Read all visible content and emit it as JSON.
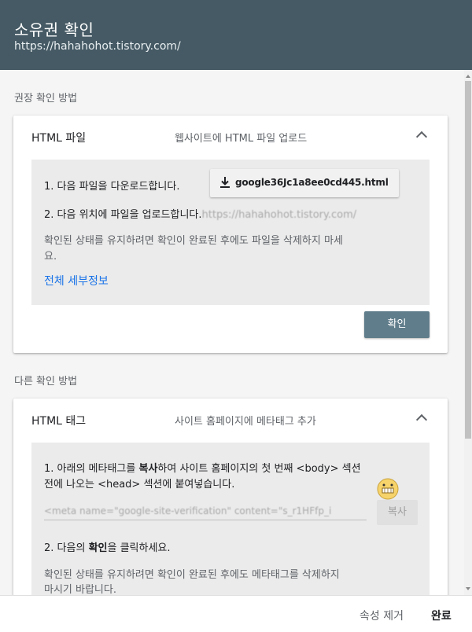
{
  "header": {
    "title": "소유권 확인",
    "url": "https://hahahohot.tistory.com/"
  },
  "recommended": {
    "section_label": "권장 확인 방법",
    "card": {
      "title": "HTML 파일",
      "desc": "웹사이트에 HTML 파일 업로드",
      "step1": "1. 다음 파일을 다운로드합니다.",
      "download_label": "google36Jc1a8ee0cd445.html",
      "step2": "2. 다음 위치에 파일을 업로드합니다.",
      "step2_location": "https://hahahohot.tistory.com/",
      "note_line1": "확인된 상태를 유지하려면 확인이 완료된 후에도 파일을 삭제하지 마세",
      "note_line2": "요.",
      "details_link": "전체 세부정보",
      "confirm_label": "확인"
    }
  },
  "other": {
    "section_label": "다른 확인 방법",
    "card": {
      "title": "HTML 태그",
      "desc": "사이트 홈페이지에 메타태그 추가",
      "step1_line1_pre": "1. 아래의 메타태그를 ",
      "step1_line1_bold": "복사",
      "step1_line1_post": "하여 사이트 홈페이지의 첫 번째 <body> 섹션",
      "step1_line2": "전에 나오는 <head> 섹션에 붙여넣습니다.",
      "meta_value": "<meta name=\"google-site-verification\" content=\"s_r1HFfp_i",
      "copy_label": "복사",
      "step2_pre": "2. 다음의 ",
      "step2_bold": "확인",
      "step2_post": "을 클릭하세요.",
      "note_line1": "확인된 상태를 유지하려면 확인이 완료된 후에도 메타태그를 삭제하지",
      "note_line2": "마시기 바랍니다."
    }
  },
  "footer": {
    "remove_label": "속성 제거",
    "done_label": "완료"
  }
}
